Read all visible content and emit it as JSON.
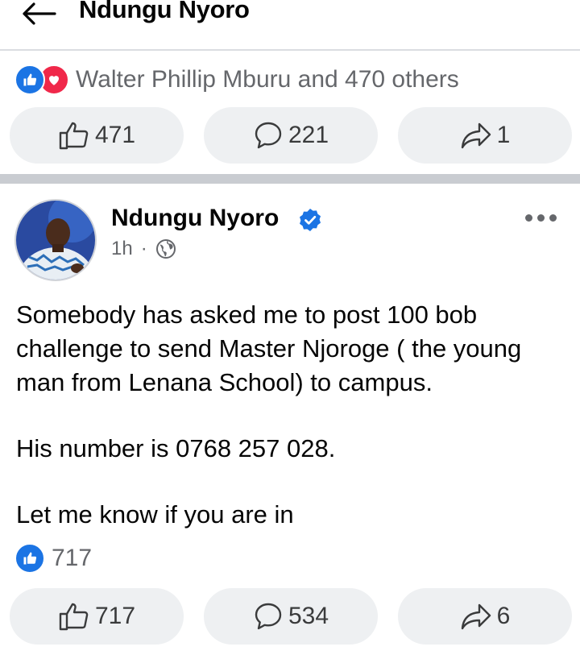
{
  "header": {
    "title": "Ndungu Nyoro"
  },
  "shared_post": {
    "reactions_text": "Walter Phillip Mburu and 470 others",
    "actions": {
      "like_count": "471",
      "comment_count": "221",
      "share_count": "1"
    }
  },
  "post": {
    "author": "Ndungu Nyoro",
    "time": "1h",
    "separator": "·",
    "paragraphs": [
      "Somebody has asked me to post 100 bob challenge to send Master Njoroge ( the young man from Lenana School) to campus.",
      "His number is 0768 257 028.",
      "Let me know if you are in"
    ],
    "reaction_count": "717",
    "actions": {
      "like_count": "717",
      "comment_count": "534",
      "share_count": "6"
    }
  },
  "colors": {
    "like_blue": "#1b74e4",
    "love_red": "#f0284a",
    "button_bg": "#eef0f2",
    "muted_text": "#65676b"
  },
  "icons": {
    "back": "arrow-left-icon",
    "like": "thumbs-up-icon",
    "comment": "comment-bubble-icon",
    "share": "share-arrow-icon",
    "verified": "verified-badge-icon",
    "privacy": "globe-icon",
    "more": "more-options-icon"
  }
}
